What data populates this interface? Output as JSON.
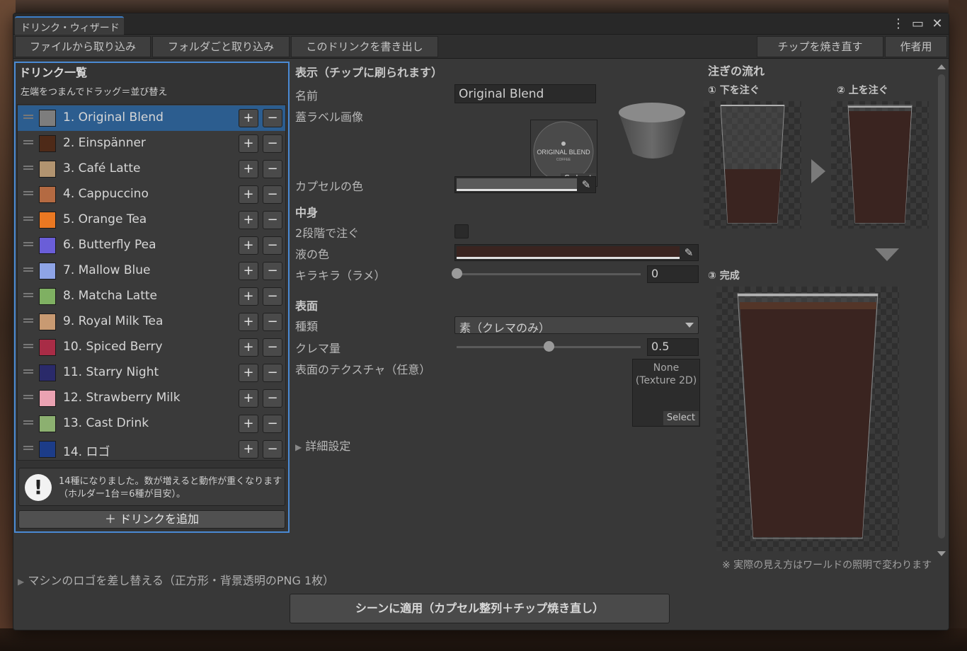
{
  "window": {
    "title": "ドリンク・ウィザード",
    "icons": [
      "more-vert-icon",
      "maximize-icon",
      "close-icon"
    ]
  },
  "toolbar": {
    "import_file": "ファイルから取り込み",
    "import_folder": "フォルダごと取り込み",
    "export_drink": "このドリンクを書き出し",
    "rebake_chips": "チップを焼き直す",
    "author": "作者用"
  },
  "drink_list": {
    "title": "ドリンク一覧",
    "hint": "左端をつまんでドラッグ＝並び替え",
    "items": [
      {
        "label": "1.  Original Blend",
        "color": "#7d7d7d",
        "selected": true
      },
      {
        "label": "2.  Einspänner",
        "color": "#4e2a18"
      },
      {
        "label": "3.  Café Latte",
        "color": "#b29470"
      },
      {
        "label": "4.  Cappuccino",
        "color": "#b46a42"
      },
      {
        "label": "5.  Orange Tea",
        "color": "#ea7822"
      },
      {
        "label": "6.  Butterfly Pea",
        "color": "#6a5ed8"
      },
      {
        "label": "7.  Mallow Blue",
        "color": "#8ea4e6"
      },
      {
        "label": "8.  Matcha Latte",
        "color": "#7fb062"
      },
      {
        "label": "9.  Royal Milk Tea",
        "color": "#c89a72"
      },
      {
        "label": "10.  Spiced Berry",
        "color": "#a82c46"
      },
      {
        "label": "11.  Starry Night",
        "color": "#2a2a6a"
      },
      {
        "label": "12.  Strawberry Milk",
        "color": "#eaa2b2"
      },
      {
        "label": "13.  Cast Drink",
        "color": "#8cb070"
      },
      {
        "label": "14.  ロゴ",
        "color": "#1c3c88"
      }
    ],
    "plus_label": "+",
    "minus_label": "−",
    "warning_icon": "!",
    "warning": "14種になりました。数が増えると動作が重くなります（ホルダー1台＝6種が目安）。",
    "add_button": "＋ ドリンクを追加"
  },
  "display": {
    "header": "表示（チップに刷られます）",
    "name_label": "名前",
    "name_value": "Original Blend",
    "lid_label": "蓋ラベル画像",
    "lid_image_text": "ORIGINAL BLEND",
    "lid_image_subtext": "COFFEE",
    "select_label": "Select",
    "capsule_color_label": "カプセルの色",
    "capsule_color": "#5a5a5a"
  },
  "contents": {
    "header": "中身",
    "two_stage_label": "2段階で注ぐ",
    "two_stage_checked": false,
    "liquid_color_label": "液の色",
    "liquid_color": "#3a2420",
    "glitter_label": "キラキラ（ラメ）",
    "glitter_value": "0",
    "glitter_fraction": 0.0
  },
  "surface": {
    "header": "表面",
    "type_label": "種類",
    "type_value": "素（クレマのみ）",
    "crema_label": "クレマ量",
    "crema_value": "0.5",
    "crema_fraction": 0.5,
    "texture_label": "表面のテクスチャ（任意）",
    "texture_value_1": "None",
    "texture_value_2": "(Texture 2D)",
    "select_label": "Select"
  },
  "advanced": {
    "foldout": "詳細設定"
  },
  "pour_flow": {
    "header": "注ぎの流れ",
    "step1": "① 下を注ぐ",
    "step2": "② 上を注ぐ",
    "step3": "③ 完成",
    "note": "※ 実際の見え方はワールドの照明で変わります",
    "liquid_color": "#3a2420"
  },
  "logo_foldout": "マシンのロゴを差し替える（正方形・背景透明のPNG 1枚）",
  "apply_button": "シーンに適用（カプセル整列＋チップ焼き直し）"
}
